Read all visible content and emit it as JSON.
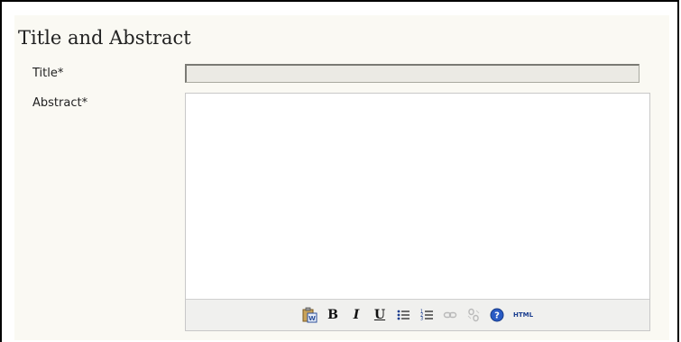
{
  "section": {
    "heading": "Title and Abstract"
  },
  "form": {
    "title_label": "Title*",
    "title_value": "",
    "abstract_label": "Abstract*"
  },
  "toolbar": {
    "bold": "B",
    "italic": "I",
    "underline": "U",
    "html": "HTML",
    "icons": [
      "paste-from-word-icon",
      "bold-icon",
      "italic-icon",
      "underline-icon",
      "bullet-list-icon",
      "numbered-list-icon",
      "insert-link-icon",
      "unlink-icon",
      "help-icon",
      "html-source-icon"
    ]
  }
}
